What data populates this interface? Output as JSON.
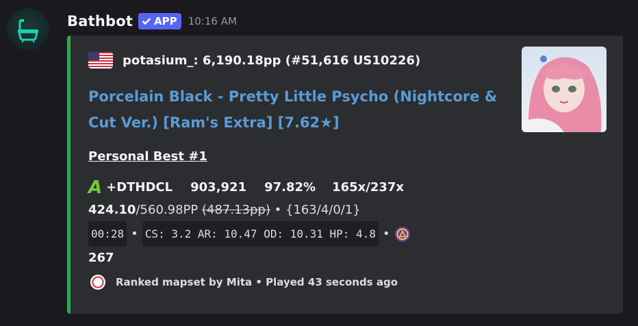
{
  "bot": {
    "name": "Bathbot",
    "badge": "APP",
    "time": "10:16 AM"
  },
  "embed": {
    "author": "potasium_: 6,190.18pp (#51,616 US10226)",
    "title": "Porcelain Black - Pretty Little Psycho (Nightcore & Cut Ver.) [Ram's Extra] [7.62★]",
    "personal_best": "Personal Best #1",
    "grade": "A",
    "mods": "+DTHDCL",
    "score": "903,921",
    "accuracy": "97.82%",
    "combo": "165x/237x",
    "pp": "424.10",
    "pp_max": "/560.98PP",
    "pp_fc": "(487.13pp)",
    "hits": "{163/4/0/1}",
    "length": "00:28",
    "map_stats": "CS: 3.2 AR: 10.47 OD: 10.31 HP: 4.8",
    "bpm": "267",
    "footer": "Ranked mapset by Mita • Played 43 seconds ago",
    "bullet": "•"
  },
  "colors": {
    "accent": "#3aa356",
    "title": "#5b9bd5",
    "badge": "#5865f2"
  },
  "icons": [
    "bathtub-icon",
    "us-flag-icon",
    "check-icon",
    "grade-a-icon",
    "mode-icon",
    "ranked-icon",
    "beatmap-thumbnail"
  ]
}
